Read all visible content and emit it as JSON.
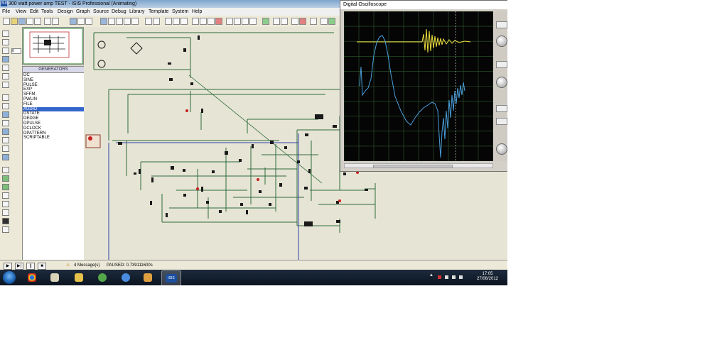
{
  "window": {
    "title": "300 watt power amp TEST - ISIS Professional (Animating)",
    "logo": "ISIS"
  },
  "menu": [
    "File",
    "View",
    "Edit",
    "Tools",
    "Design",
    "Graph",
    "Source",
    "Debug",
    "Library",
    "Template",
    "System",
    "Help"
  ],
  "left_panel": {
    "spin_value": "0",
    "generators_title": "GENERATORS",
    "generators": [
      "DC",
      "SINE",
      "PULSE",
      "EXP",
      "SFFM",
      "PWLIN",
      "FILE",
      "AUDIO",
      "DSTATE",
      "DEDGE",
      "DPULSE",
      "DCLOCK",
      "DPATTERN",
      "SCRIPTABLE"
    ],
    "selected_index": 7
  },
  "status": {
    "messages": "4 Message(s)",
    "paused": "PAUSED: 0.739111600s"
  },
  "oscilloscope": {
    "title": "Digital Oscilloscope",
    "trace_colors": {
      "ch_a": "#f0e040",
      "ch_b": "#4a9fdc"
    }
  },
  "taskbar": {
    "time": "17:05",
    "date": "27/06/2012",
    "active_app_label": "ISIS"
  },
  "colors": {
    "canvas": "#e6e4d4",
    "wire": "#2e6b3e",
    "grid": "#3a6a3a",
    "selection": "#3366cc"
  }
}
